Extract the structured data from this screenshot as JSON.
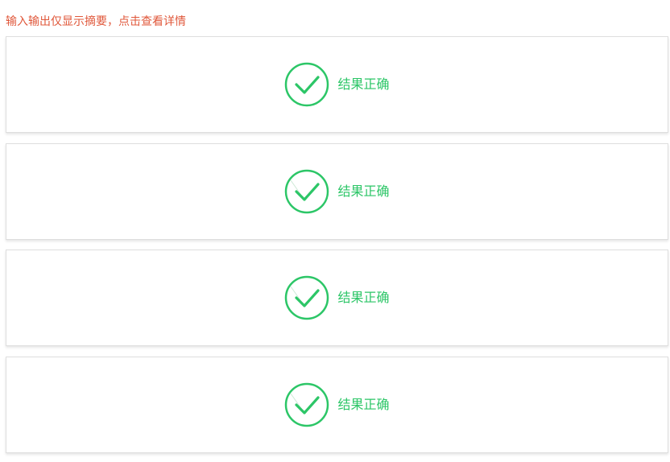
{
  "hint": "输入输出仅显示摘要，点击查看详情",
  "colors": {
    "hint": "#e0583b",
    "success": "#2cc667",
    "card_border": "#dedede"
  },
  "cases": [
    {
      "status_text": "结果正确",
      "icon": "check-circle-icon"
    },
    {
      "status_text": "结果正确",
      "icon": "check-circle-icon"
    },
    {
      "status_text": "结果正确",
      "icon": "check-circle-icon"
    },
    {
      "status_text": "结果正确",
      "icon": "check-circle-icon"
    }
  ]
}
